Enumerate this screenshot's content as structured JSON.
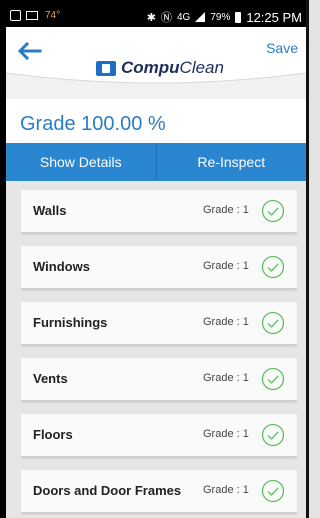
{
  "status_bar": {
    "temperature": "74°",
    "battery_percent": "79%",
    "time": "12:25 PM",
    "network": "4G"
  },
  "header": {
    "save_label": "Save",
    "logo_text_1": "Compu",
    "logo_text_2": "Clean"
  },
  "grade": {
    "text": "Grade 100.00 %"
  },
  "actions": {
    "show_details": "Show Details",
    "re_inspect": "Re-Inspect"
  },
  "items": [
    {
      "label": "Walls",
      "grade": "Grade : 1"
    },
    {
      "label": "Windows",
      "grade": "Grade : 1"
    },
    {
      "label": "Furnishings",
      "grade": "Grade : 1"
    },
    {
      "label": "Vents",
      "grade": "Grade : 1"
    },
    {
      "label": "Floors",
      "grade": "Grade : 1"
    },
    {
      "label": "Doors and Door Frames",
      "grade": "Grade : 1"
    }
  ],
  "colors": {
    "accent": "#2a86d0",
    "check": "#5cc05c"
  }
}
